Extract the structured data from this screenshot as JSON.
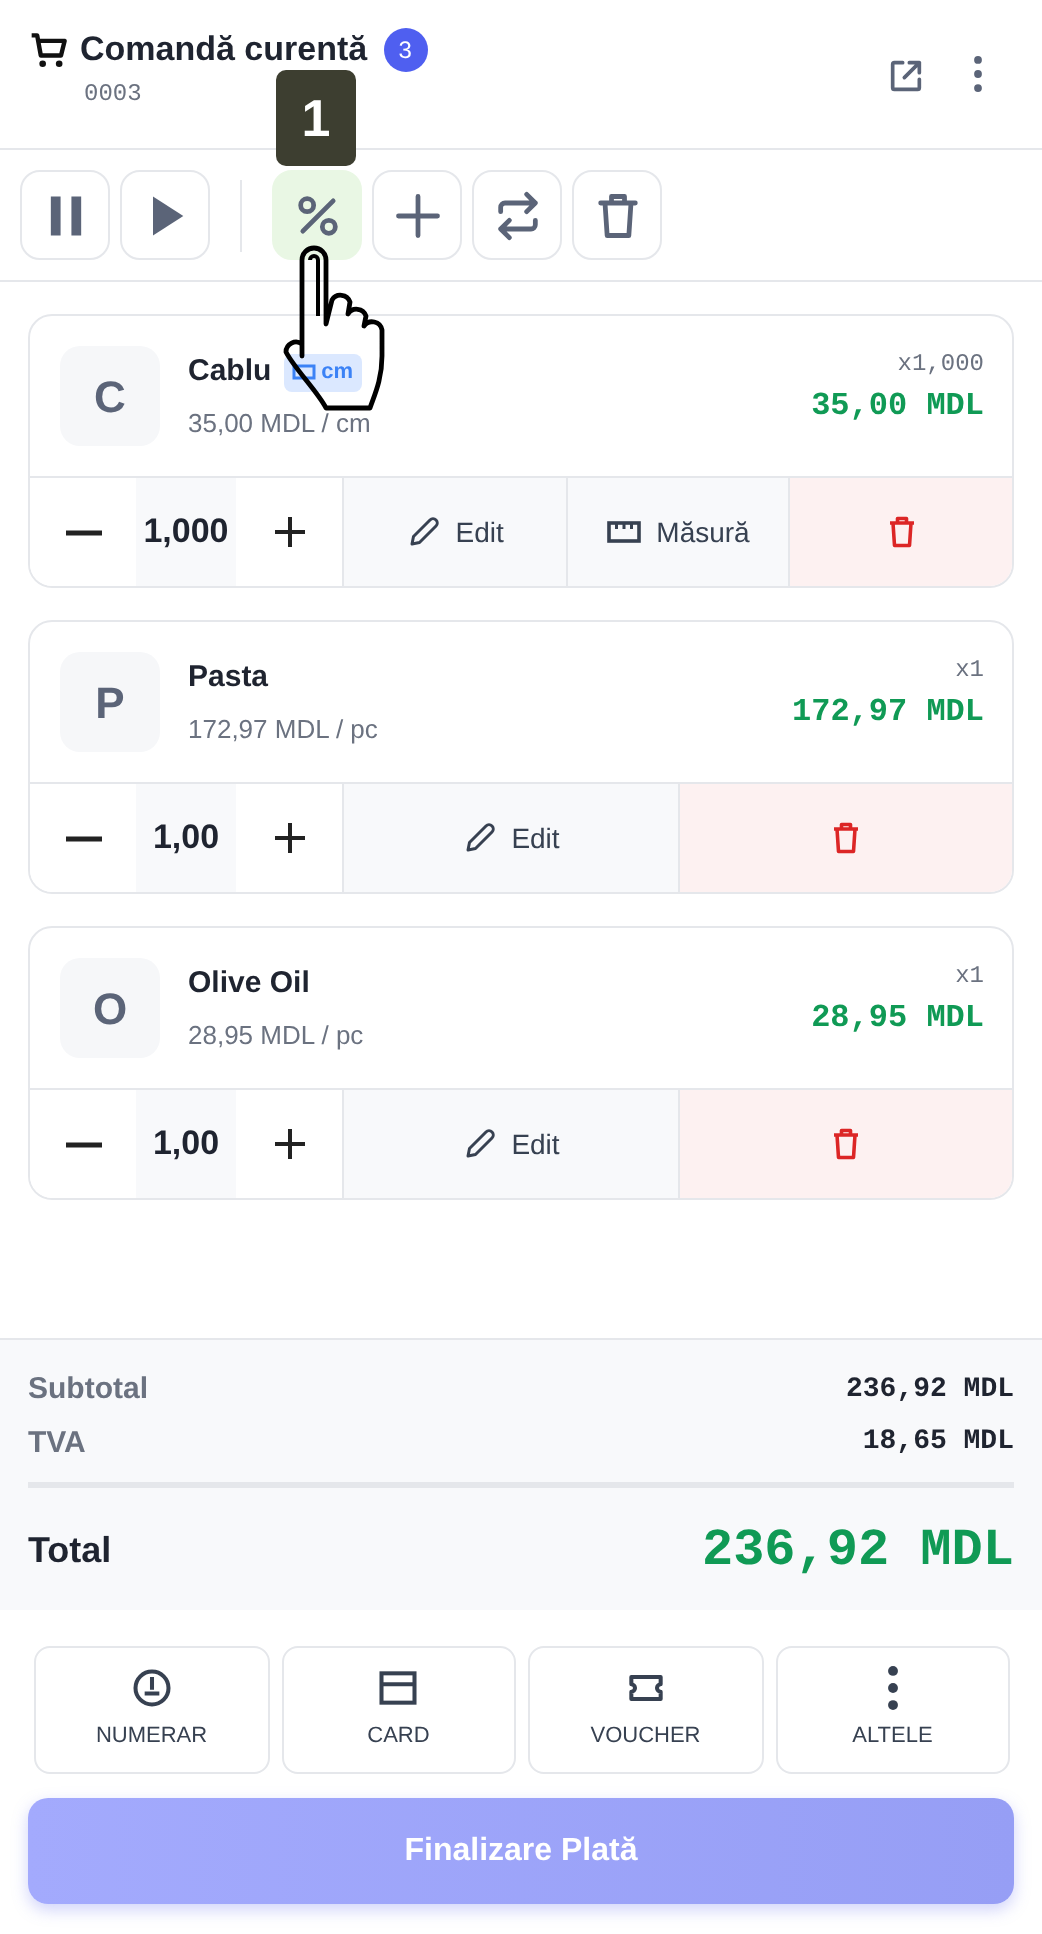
{
  "header": {
    "title": "Comandă curentă",
    "count_badge": "3",
    "order_number": "0003"
  },
  "tutorial_step": {
    "label": "1"
  },
  "toolbar": [
    {
      "kind": "pause",
      "highlighted": false
    },
    {
      "kind": "play",
      "highlighted": false
    },
    {
      "kind": "divider"
    },
    {
      "kind": "percent",
      "highlighted": true
    },
    {
      "kind": "plus",
      "highlighted": false
    },
    {
      "kind": "swap",
      "highlighted": false
    },
    {
      "kind": "trash",
      "highlighted": false
    }
  ],
  "items": [
    {
      "letter": "C",
      "name": "Cablu",
      "unit_badge": "cm",
      "unit_price": "35,00 MDL / cm",
      "multiplier": "x1,000",
      "total": "35,00 MDL",
      "quantity": "1,000",
      "actions": [
        {
          "kind": "edit",
          "label": "Edit"
        },
        {
          "kind": "measure",
          "label": "Măsură"
        },
        {
          "kind": "delete"
        }
      ]
    },
    {
      "letter": "P",
      "name": "Pasta",
      "unit_price": "172,97 MDL / pc",
      "multiplier": "x1",
      "total": "172,97 MDL",
      "quantity": "1,00",
      "actions": [
        {
          "kind": "edit",
          "label": "Edit"
        },
        {
          "kind": "delete"
        }
      ]
    },
    {
      "letter": "O",
      "name": "Olive Oil",
      "unit_price": "28,95 MDL / pc",
      "multiplier": "x1",
      "total": "28,95 MDL",
      "quantity": "1,00",
      "actions": [
        {
          "kind": "edit",
          "label": "Edit"
        },
        {
          "kind": "delete"
        }
      ]
    }
  ],
  "summary": {
    "rows": [
      {
        "label": "Subtotal",
        "value": "236,92 MDL"
      },
      {
        "label": "TVA",
        "value": "18,65 MDL"
      }
    ],
    "total_label": "Total",
    "total_value": "236,92 MDL"
  },
  "payment_methods": [
    {
      "kind": "cash",
      "label": "NUMERAR"
    },
    {
      "kind": "card",
      "label": "CARD"
    },
    {
      "kind": "voucher",
      "label": "VOUCHER"
    },
    {
      "kind": "more",
      "label": "ALTELE"
    }
  ],
  "finalize": {
    "label": "Finalizare Plată",
    "disabled": true
  }
}
